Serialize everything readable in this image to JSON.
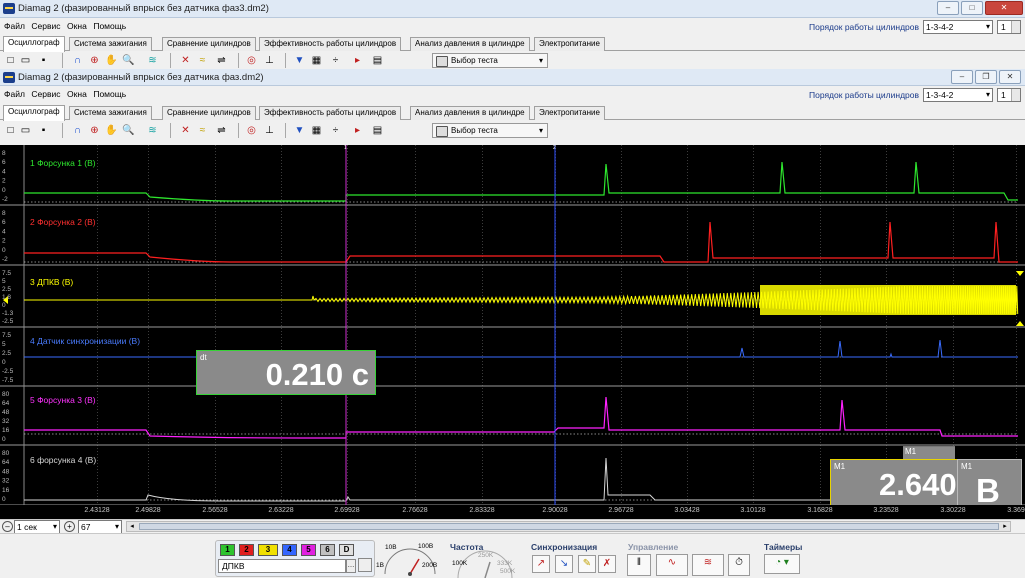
{
  "back_window": {
    "title": "Diamag 2 (фазированный впрыск без датчика фаз3.dm2)",
    "menu": [
      "Файл",
      "Сервис",
      "Окна",
      "Помощь"
    ],
    "cyl_order_label": "Порядок работы цилиндров",
    "cyl_order_value": "1-3-4-2",
    "cyl_count": "1",
    "tabs": [
      "Осциллограф",
      "Система зажигания",
      "Сравнение цилиндров",
      "Эффективность работы цилиндров",
      "Анализ давления в цилиндре",
      "Электропитание"
    ],
    "test_select": "Выбор теста"
  },
  "front_window": {
    "title": "Diamag 2 (фазированный впрыск без датчика фаз.dm2)",
    "menu": [
      "Файл",
      "Сервис",
      "Окна",
      "Помощь"
    ],
    "cyl_order_label": "Порядок работы цилиндров",
    "cyl_order_value": "1-3-4-2",
    "cyl_count": "1",
    "tabs": [
      "Осциллограф",
      "Система зажигания",
      "Сравнение цилиндров",
      "Эффективность работы цилиндров",
      "Анализ давления в цилиндре",
      "Электропитание"
    ],
    "test_select": "Выбор теста"
  },
  "channels": [
    {
      "label": "1 Форсунка 1 (В)",
      "color": "#2ee62e",
      "ticks": [
        "8",
        "6",
        "4",
        "2",
        "0",
        "-2"
      ]
    },
    {
      "label": "2 Форсунка 2 (В)",
      "color": "#ff2020",
      "ticks": [
        "8",
        "6",
        "4",
        "2",
        "0",
        "-2"
      ]
    },
    {
      "label": "3 ДПКВ (В)",
      "color": "#ffff00",
      "ticks": [
        "7.5",
        "5",
        "2.5",
        "1.8",
        "0",
        "-1.3",
        "-2.5"
      ]
    },
    {
      "label": "4 Датчик синхронизации (В)",
      "color": "#3a6cff",
      "ticks": [
        "7.5",
        "5",
        "2.5",
        "0",
        "-2.5",
        "-7.5"
      ]
    },
    {
      "label": "5 Форсунка 3 (В)",
      "color": "#ff22ff",
      "ticks": [
        "80",
        "64",
        "48",
        "32",
        "16",
        "0"
      ]
    },
    {
      "label": "6 форсунка 4 (В)",
      "color": "#d8d8d8",
      "ticks": [
        "80",
        "64",
        "48",
        "32",
        "16",
        "0"
      ]
    }
  ],
  "cursors": {
    "c1": "1",
    "c2": "2"
  },
  "x_ticks": [
    "2.43128",
    "2.49828",
    "2.56528",
    "2.63228",
    "2.69928",
    "2.76628",
    "2.83328",
    "2.90028",
    "2.96728",
    "3.03428",
    "3.10128",
    "3.16828",
    "3.23528",
    "3.30228",
    "3.369"
  ],
  "measure_dt": {
    "caption": "dt",
    "value": "0.210 с"
  },
  "measure_m1": {
    "caption": "M1",
    "value": "2.640"
  },
  "measure_m1_top": {
    "caption": "M1"
  },
  "measure_unit": {
    "caption": "M1",
    "value": "В"
  },
  "timebase": {
    "value": "1 сек",
    "zoom": "67"
  },
  "bottom_panel": {
    "channel_buttons": [
      {
        "label": "1",
        "color": "#2ec42e"
      },
      {
        "label": "2",
        "color": "#e02020"
      },
      {
        "label": "3",
        "color": "#f0e000"
      },
      {
        "label": "4",
        "color": "#3366ff"
      },
      {
        "label": "5",
        "color": "#e020e0"
      },
      {
        "label": "6",
        "color": "#c0c0c0"
      },
      {
        "label": "D",
        "color": "#e0e0e0"
      }
    ],
    "channel_name": "ДПКВ",
    "range_labels": [
      "10В",
      "100В",
      "1В",
      "200В"
    ],
    "freq_title": "Частота",
    "freq_labels": [
      "250K",
      "100K",
      "333K",
      "500K"
    ],
    "sync_title": "Синхронизация",
    "control_title": "Управление",
    "timers_title": "Таймеры"
  }
}
